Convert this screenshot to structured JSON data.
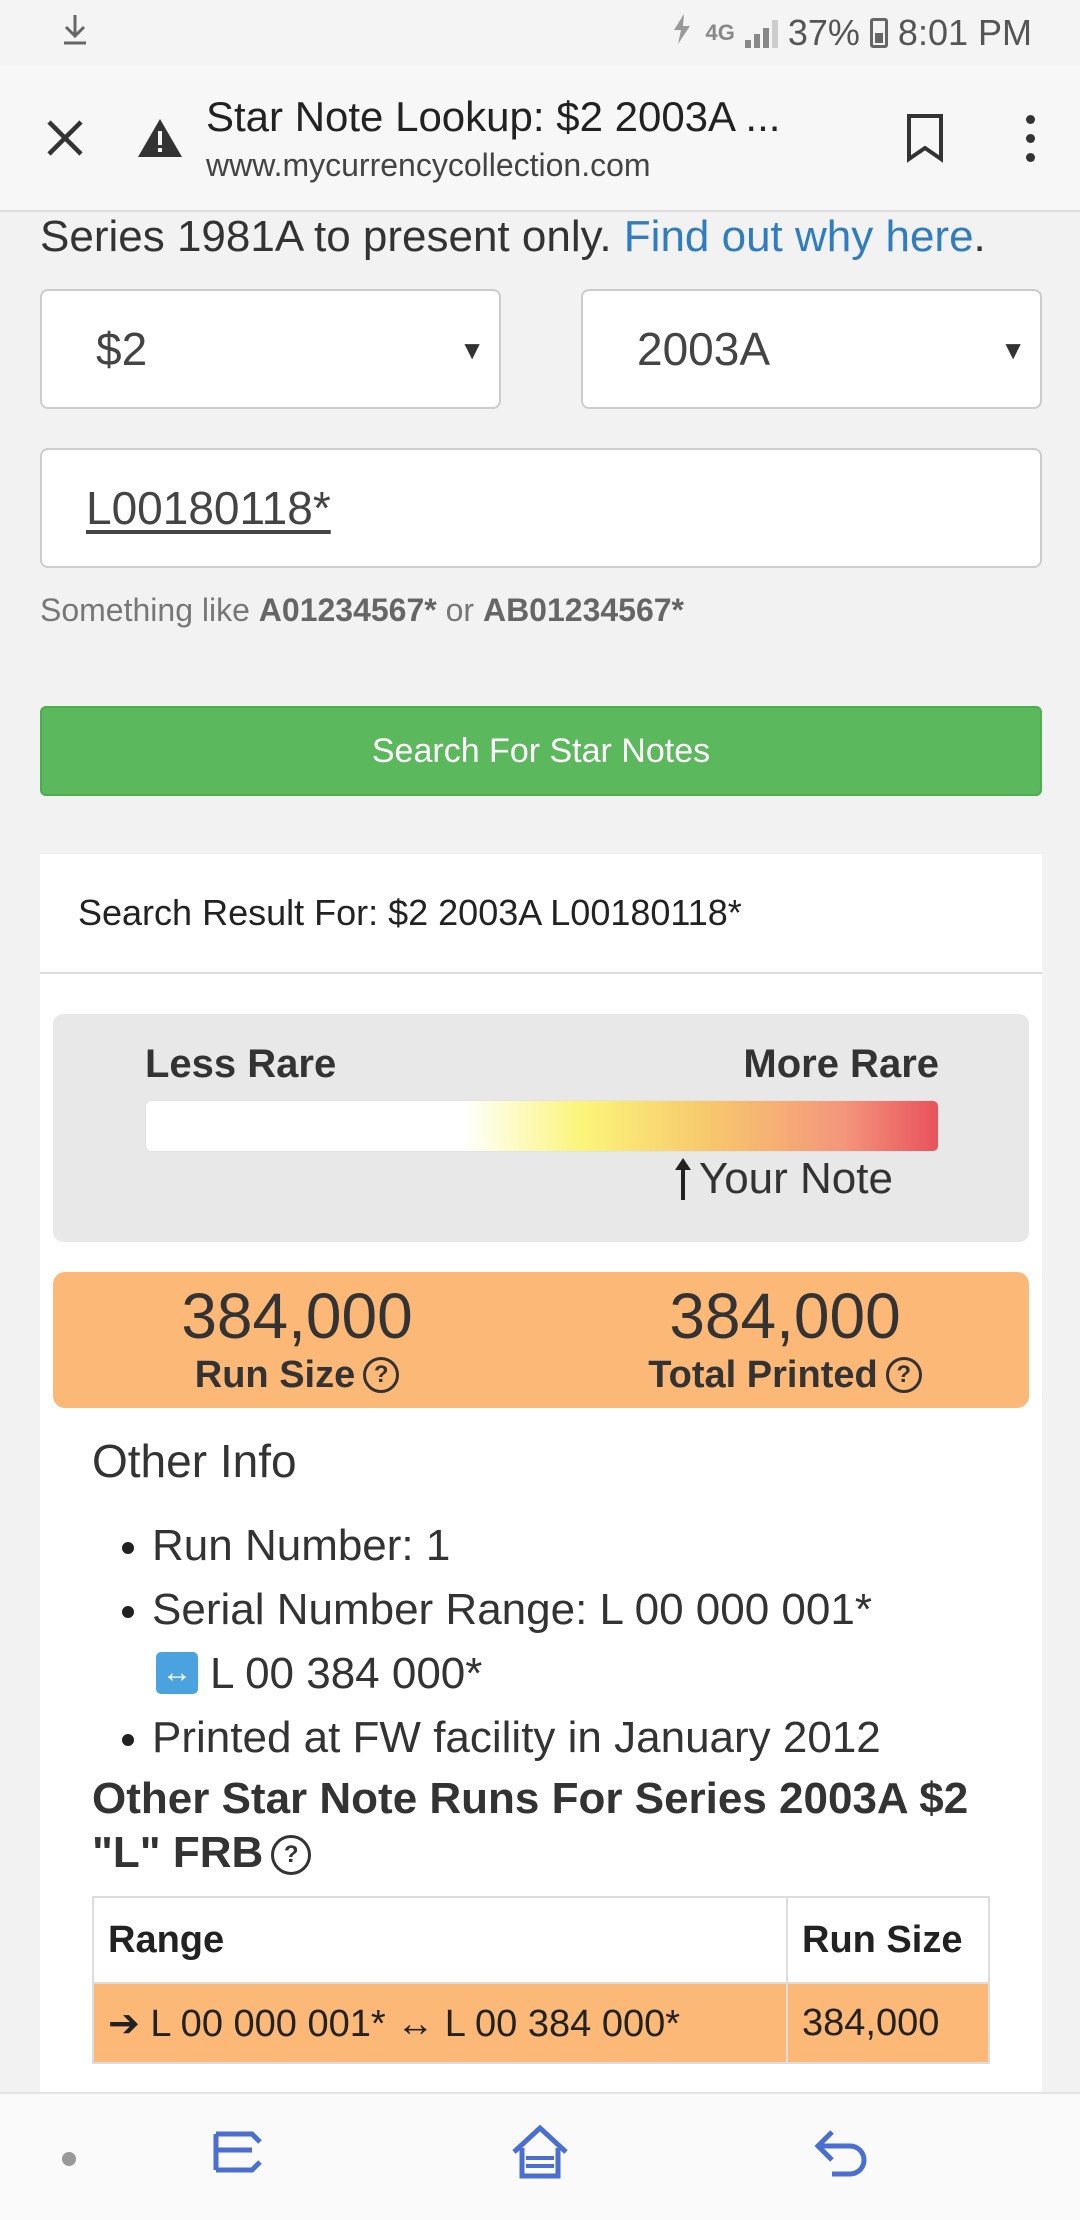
{
  "status_bar": {
    "network": "4G",
    "battery": "37%",
    "time": "8:01 PM"
  },
  "browser": {
    "title": "Star Note Lookup: $2 2003A ...",
    "url": "www.mycurrencycollection.com"
  },
  "page": {
    "intro_text": "Series 1981A to present only.",
    "intro_link": "Find out why here",
    "intro_end": ".",
    "denomination": "$2",
    "series": "2003A",
    "serial_value": "L00180118*",
    "hint_prefix": "Something like",
    "hint_example1": "A01234567*",
    "hint_or": "or",
    "hint_example2": "AB01234567*",
    "search_button": "Search For Star Notes"
  },
  "result": {
    "heading": "Search Result For: $2 2003A L00180118*",
    "rarity": {
      "less_label": "Less Rare",
      "more_label": "More Rare",
      "your_note_label": "Your Note",
      "marker_position_fraction": 0.68
    },
    "run_size": {
      "value": "384,000",
      "label": "Run Size"
    },
    "total_printed": {
      "value": "384,000",
      "label": "Total Printed"
    },
    "other_info": {
      "title": "Other Info",
      "run_number": "Run Number: 1",
      "range_start": "Serial Number Range: L 00 000 001*",
      "range_end": "L 00 384 000*",
      "printed_at": "Printed at FW facility in January 2012"
    },
    "other_runs": {
      "title": "Other Star Note Runs For Series 2003A $2 \"L\" FRB",
      "columns": [
        "Range",
        "Run Size"
      ],
      "rows": [
        {
          "range": "➔ L 00 000 001* ↔ L 00 384 000*",
          "run_size": "384,000"
        }
      ]
    }
  },
  "colors": {
    "link": "#2f7cc1",
    "search_button": "#5cb85c",
    "run_box": "#fbb877",
    "nav_icon": "#4a6fd1"
  }
}
